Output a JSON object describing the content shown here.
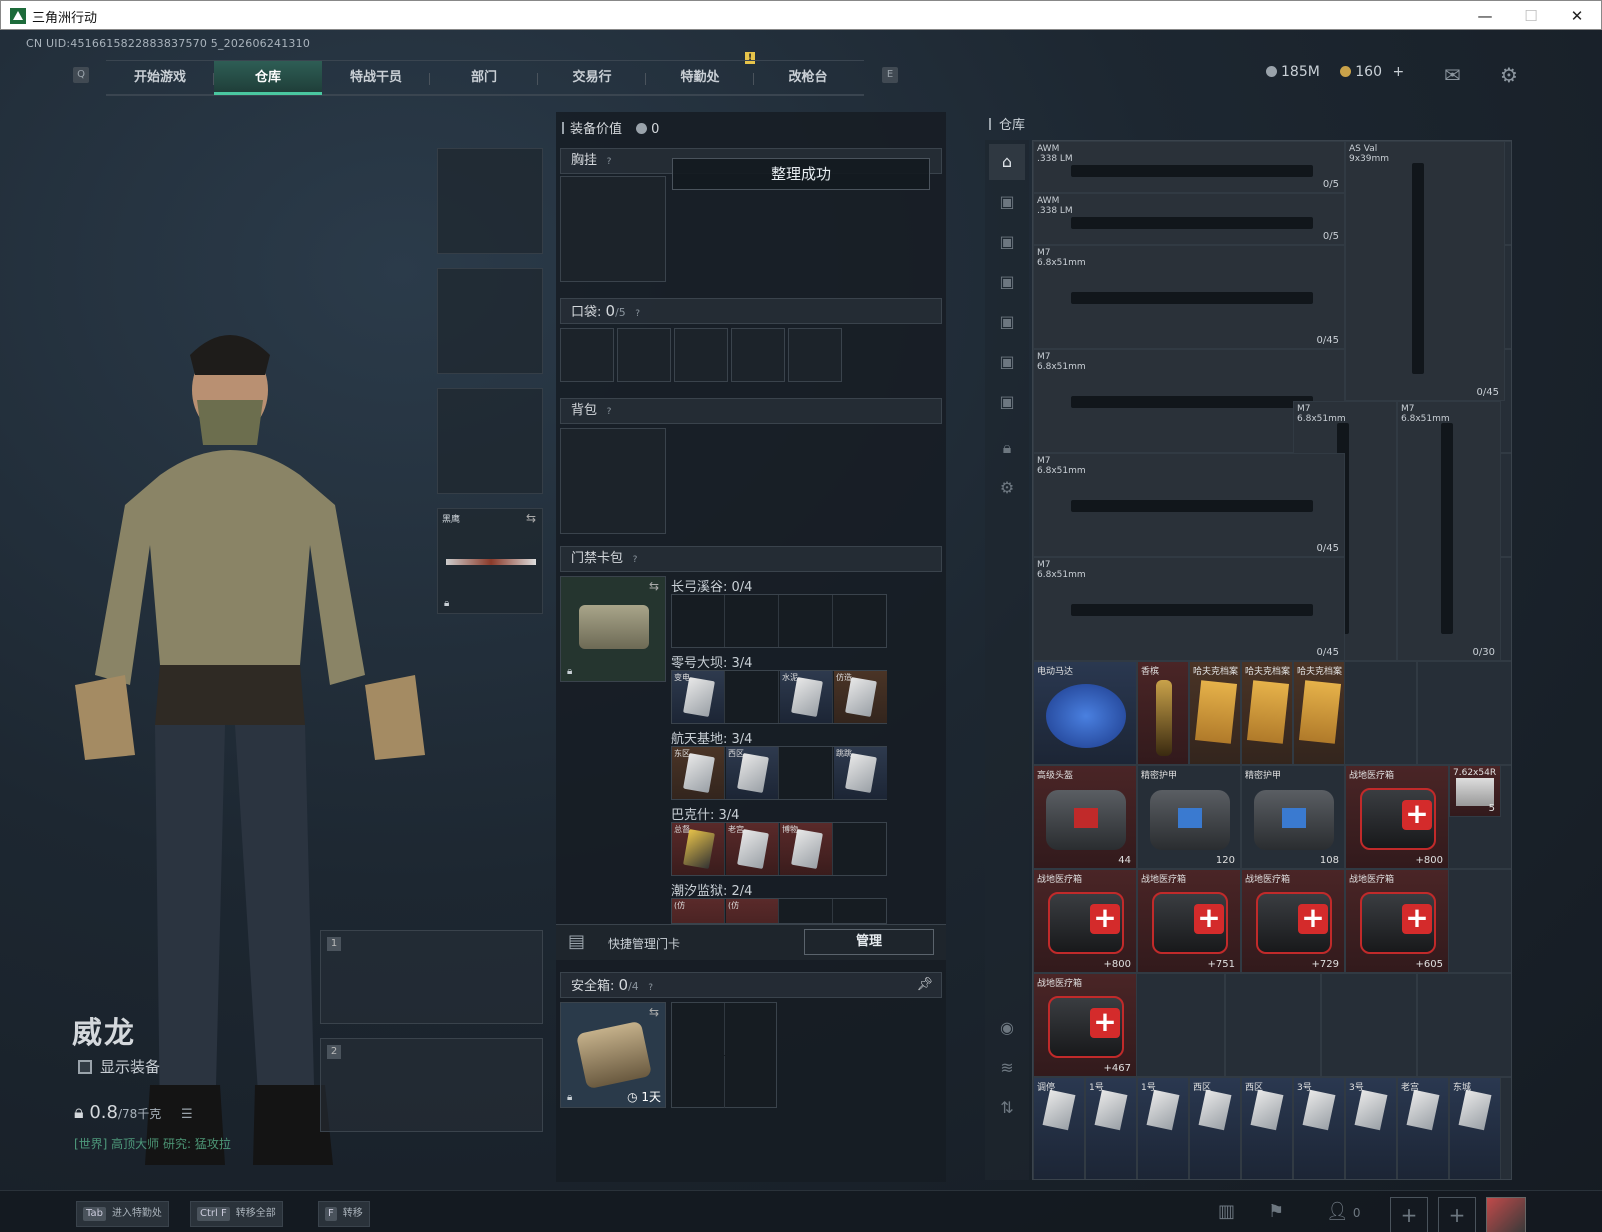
{
  "window": {
    "title": "三角洲行动",
    "controls": [
      "—",
      "☐",
      "✕"
    ]
  },
  "uid": "CN UID:4516615822883837570 5_202606241310",
  "nav": {
    "left_key": "Q",
    "right_key": "E",
    "tabs": [
      {
        "label": "开始游戏"
      },
      {
        "label": "仓库"
      },
      {
        "label": "特战干员"
      },
      {
        "label": "部门"
      },
      {
        "label": "交易行"
      },
      {
        "label": "特勤处"
      },
      {
        "label": "改枪台"
      }
    ],
    "active_tab": "仓库",
    "alert": "!"
  },
  "currency": {
    "coins": "185M",
    "tickets": "160",
    "plus": "+"
  },
  "character": {
    "name": "威龙",
    "show_equipment": "显示装备",
    "weight_value": "0.8",
    "weight_max": "/78千克",
    "tagline": "[世界] 高顶大师 研究: 猛攻拉"
  },
  "equip_slots": {
    "melee_label": "黑鹰"
  },
  "weapon_slots": [
    "1",
    "2"
  ],
  "loadout": {
    "value_label": "装备价值",
    "value": "0",
    "chest": "胸挂",
    "toast": "整理成功",
    "pockets_label": "口袋:",
    "pockets_value": "0",
    "pockets_max": "/5",
    "backpack": "背包",
    "keycase": "门禁卡包",
    "maps": [
      {
        "name": "长弓溪谷: 0/4",
        "cards": [
          0,
          0,
          0,
          0
        ],
        "labels": [
          "",
          "",
          "",
          ""
        ]
      },
      {
        "name": "零号大坝: 3/4",
        "cards": [
          1,
          0,
          1,
          1
        ],
        "labels": [
          "变电",
          "",
          "水泥",
          "仿造"
        ]
      },
      {
        "name": "航天基地: 3/4",
        "cards": [
          1,
          1,
          0,
          1
        ],
        "labels": [
          "东区",
          "西区",
          "",
          "跳跳"
        ]
      },
      {
        "name": "巴克什: 3/4",
        "cards": [
          2,
          2,
          2,
          0
        ],
        "labels": [
          "总督",
          "老宫",
          "博物",
          ""
        ]
      },
      {
        "name": "潮汐监狱: 2/4",
        "cards": [
          2,
          2,
          0,
          0
        ],
        "labels": [
          "(仿",
          "(仿",
          "",
          ""
        ]
      }
    ],
    "quick_manage": "快捷管理门卡",
    "manage_btn": "管理",
    "safebox_label": "安全箱:",
    "safebox_value": "0",
    "safebox_max": "/4",
    "safebox_time": "1天"
  },
  "stash": {
    "title": "仓库",
    "guns": [
      {
        "name": "AWM\n.338 LM",
        "amt": "0/5"
      },
      {
        "name": "AWM\n.338 LM",
        "amt": "0/5"
      },
      {
        "name": "AS Val\n9x39mm",
        "amt": "0/45"
      },
      {
        "name": "M7\n6.8x51mm",
        "amt": "0/45"
      },
      {
        "name": "M7\n6.8x51mm",
        "amt": "0/45"
      },
      {
        "name": "M7\n6.8x51mm",
        "amt": ""
      },
      {
        "name": "M7\n6.8x51mm",
        "amt": "0/45"
      },
      {
        "name": "M7\n6.8x51mm",
        "amt": "0/30"
      },
      {
        "name": "M7\n6.8x51mm",
        "amt": "0/45"
      },
      {
        "name": "M7\n6.8x51mm",
        "amt": "0/30"
      }
    ],
    "items": [
      {
        "name": "电动马达",
        "amt": ""
      },
      {
        "name": "香槟",
        "amt": ""
      },
      {
        "name": "哈夫克档案",
        "amt": ""
      },
      {
        "name": "哈夫克档案",
        "amt": ""
      },
      {
        "name": "哈夫克档案",
        "amt": ""
      },
      {
        "name": "高级头盔",
        "amt": "44"
      },
      {
        "name": "精密护甲",
        "amt": "120"
      },
      {
        "name": "精密护甲",
        "amt": "108"
      },
      {
        "name": "战地医疗箱",
        "amt": "+800"
      },
      {
        "name": "7.62x54R",
        "amt": "5"
      },
      {
        "name": "战地医疗箱",
        "amt": "+800"
      },
      {
        "name": "战地医疗箱",
        "amt": "+751"
      },
      {
        "name": "战地医疗箱",
        "amt": "+729"
      },
      {
        "name": "战地医疗箱",
        "amt": "+605"
      },
      {
        "name": "战地医疗箱",
        "amt": "+467"
      }
    ],
    "cards_row": [
      "调停",
      "1号",
      "1号",
      "西区",
      "西区",
      "3号",
      "3号",
      "老宫",
      "东城"
    ]
  },
  "bottom": {
    "hotkeys": [
      {
        "key": "Tab",
        "label": "进入特勤处"
      },
      {
        "key": "Ctrl F",
        "label": "转移全部"
      },
      {
        "key": "F",
        "label": "转移"
      }
    ],
    "friends": "0"
  },
  "colors": {
    "accent": "#4ac7a0",
    "medkit_red": "#d42b2b",
    "gold": "#e6c34a"
  }
}
